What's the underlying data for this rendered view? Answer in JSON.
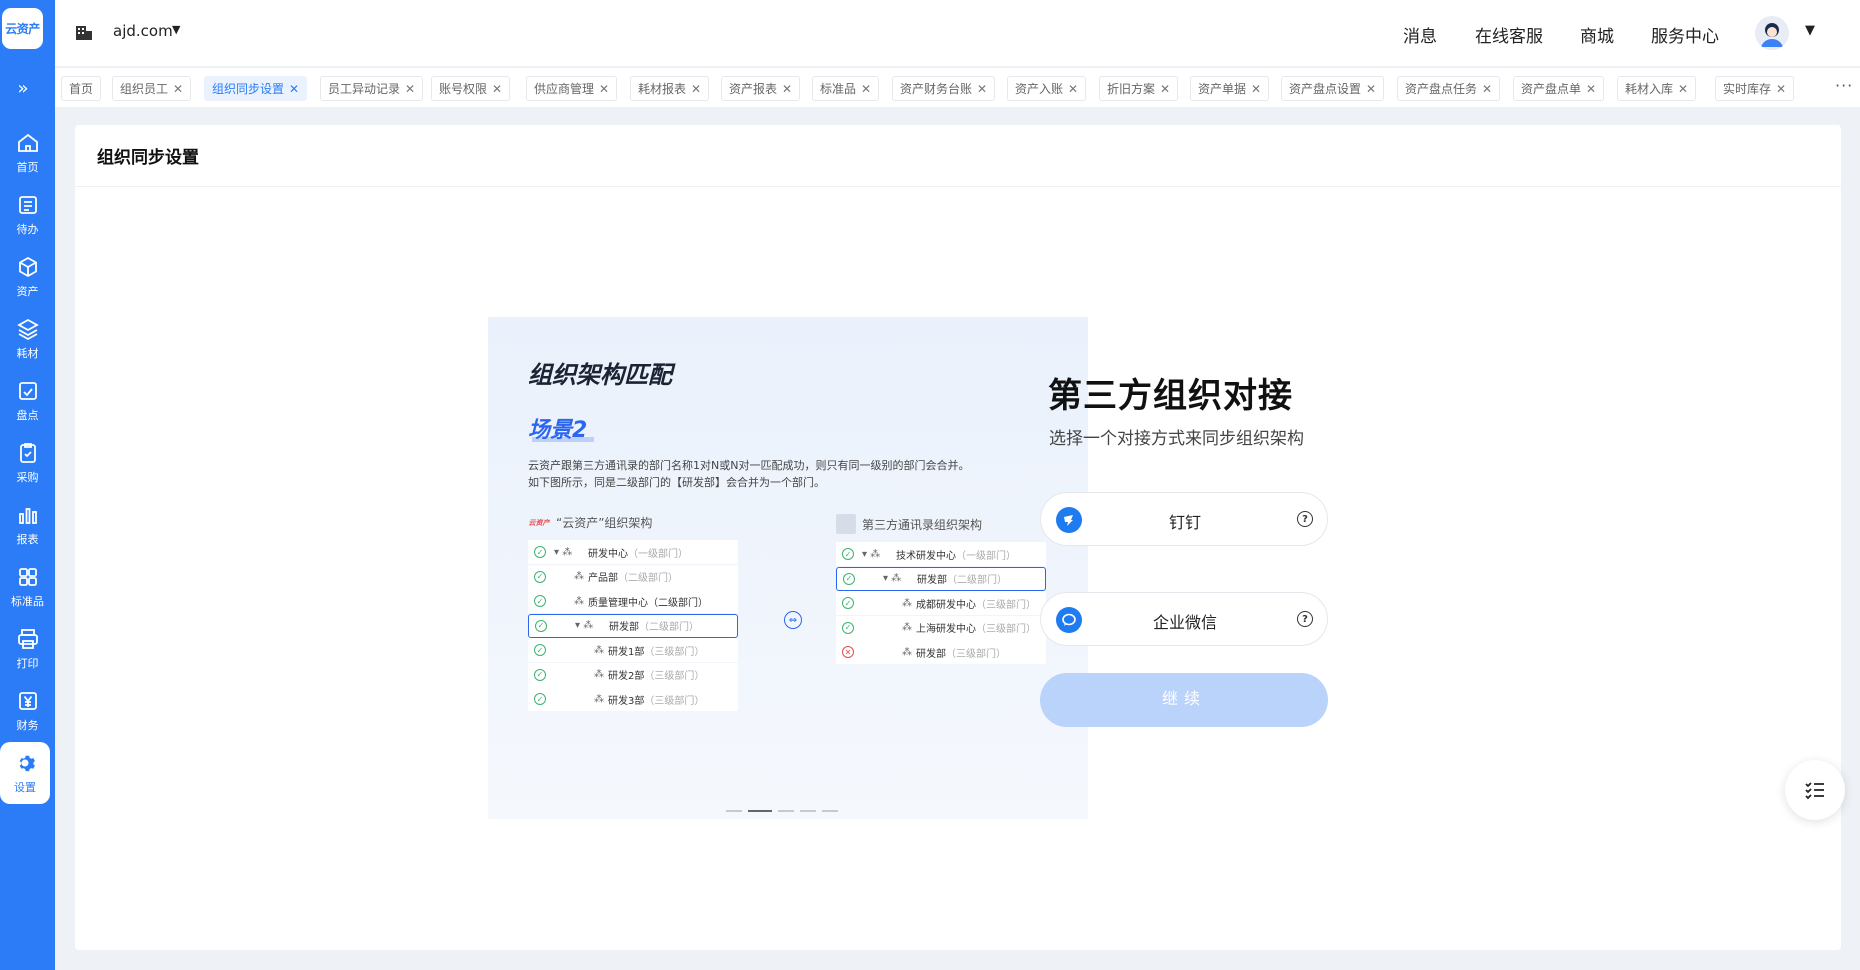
{
  "sidebar": {
    "logo": "云资产",
    "expand_glyph": "»",
    "items": [
      {
        "label": "首页",
        "icon": "home-icon"
      },
      {
        "label": "待办",
        "icon": "todo-icon"
      },
      {
        "label": "资产",
        "icon": "cube-icon"
      },
      {
        "label": "耗材",
        "icon": "layers-icon"
      },
      {
        "label": "盘点",
        "icon": "calendar-check-icon"
      },
      {
        "label": "采购",
        "icon": "clipboard-check-icon"
      },
      {
        "label": "报表",
        "icon": "bar-chart-icon"
      },
      {
        "label": "标准品",
        "icon": "grid-icon"
      },
      {
        "label": "打印",
        "icon": "printer-icon"
      },
      {
        "label": "财务",
        "icon": "yuan-icon"
      },
      {
        "label": "设置",
        "icon": "gear-icon",
        "active": true
      }
    ]
  },
  "topbar": {
    "domain": "ajd.com",
    "links": [
      "消息",
      "在线客服",
      "商城",
      "服务中心"
    ]
  },
  "tabs": [
    {
      "label": "首页",
      "closable": false
    },
    {
      "label": "组织员工",
      "closable": true
    },
    {
      "label": "组织同步设置",
      "closable": true,
      "active": true
    },
    {
      "label": "员工异动记录",
      "closable": true
    },
    {
      "label": "账号权限",
      "closable": true
    },
    {
      "label": "供应商管理",
      "closable": true
    },
    {
      "label": "耗材报表",
      "closable": true
    },
    {
      "label": "资产报表",
      "closable": true
    },
    {
      "label": "标准品",
      "closable": true
    },
    {
      "label": "资产财务台账",
      "closable": true
    },
    {
      "label": "资产入账",
      "closable": true
    },
    {
      "label": "折旧方案",
      "closable": true
    },
    {
      "label": "资产单据",
      "closable": true
    },
    {
      "label": "资产盘点设置",
      "closable": true
    },
    {
      "label": "资产盘点任务",
      "closable": true
    },
    {
      "label": "资产盘点单",
      "closable": true
    },
    {
      "label": "耗材入库",
      "closable": true
    },
    {
      "label": "实时库存",
      "closable": true
    }
  ],
  "page": {
    "title": "组织同步设置"
  },
  "illustration": {
    "heading": "组织架构匹配",
    "scenario": "场景2",
    "desc_line1": "云资产跟第三方通讯录的部门名称1对N或N对一匹配成功，则只有同一级别的部门会合并。",
    "desc_line2": "如下图所示，同是二级部门的【研发部】会合并为一个部门。",
    "left_title": "“云资产”组织架构",
    "left_icon_text": "云资产",
    "right_title": "第三方通讯录组织架构",
    "left_tree": [
      {
        "name": "研发中心",
        "level": "（一级部门）",
        "indent": 0,
        "caret": true,
        "status": "ok"
      },
      {
        "name": "产品部",
        "level": "（二级部门）",
        "indent": 1,
        "status": "ok"
      },
      {
        "name": "质量管理中心（二级部门）",
        "level": "",
        "indent": 1,
        "status": "ok"
      },
      {
        "name": "研发部",
        "level": "（二级部门）",
        "indent": 1,
        "caret": true,
        "status": "ok",
        "highlight": true
      },
      {
        "name": "研发1部",
        "level": "（三级部门）",
        "indent": 2,
        "status": "ok"
      },
      {
        "name": "研发2部",
        "level": "（三级部门）",
        "indent": 2,
        "status": "ok"
      },
      {
        "name": "研发3部",
        "level": "（三级部门）",
        "indent": 2,
        "status": "ok"
      }
    ],
    "right_tree": [
      {
        "name": "技术研发中心",
        "level": "（一级部门）",
        "indent": 0,
        "caret": true,
        "status": "ok"
      },
      {
        "name": "研发部",
        "level": "（二级部门）",
        "indent": 1,
        "caret": true,
        "status": "ok",
        "highlight": true
      },
      {
        "name": "成都研发中心",
        "level": "（三级部门）",
        "indent": 2,
        "status": "ok"
      },
      {
        "name": "上海研发中心",
        "level": "（三级部门）",
        "indent": 2,
        "status": "ok"
      },
      {
        "name": "研发部",
        "level": "（三级部门）",
        "indent": 2,
        "status": "err"
      }
    ],
    "carousel_active_index": 1,
    "carousel_count": 5
  },
  "integration": {
    "title": "第三方组织对接",
    "subtitle": "选择一个对接方式来同步组织架构",
    "options": [
      {
        "label": "钉钉",
        "icon": "dingtalk-icon"
      },
      {
        "label": "企业微信",
        "icon": "wecom-icon"
      }
    ],
    "continue_label": "继续",
    "continue_disabled": true
  },
  "colors": {
    "primary": "#2b7cf6",
    "continue_disabled_bg": "#b9d3fb",
    "page_bg": "#eef1f6"
  }
}
